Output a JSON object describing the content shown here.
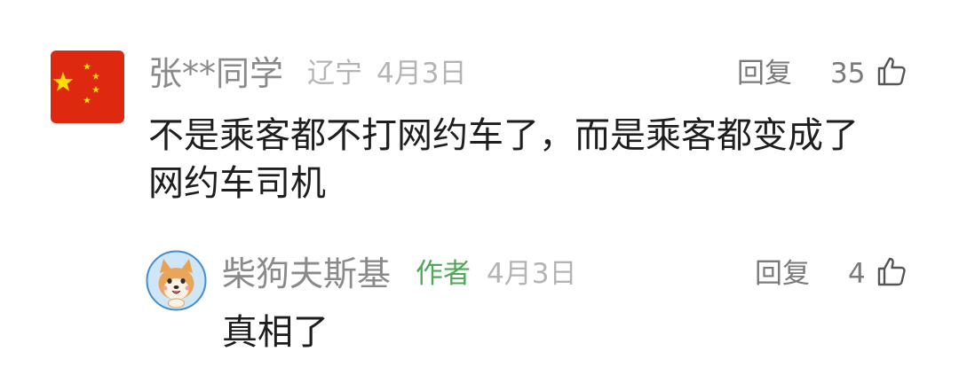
{
  "comments": [
    {
      "username": "张**同学",
      "region": "辽宁",
      "date": "4月3日",
      "reply_label": "回复",
      "likes": "35",
      "text": "不是乘客都不打网约车了，而是乘客都变成了\n网约车司机",
      "avatar_icon": "china-flag-icon"
    }
  ],
  "replies": [
    {
      "username": "柴狗夫斯基",
      "author_tag": "作者",
      "date": "4月3日",
      "reply_label": "回复",
      "likes": "4",
      "text": "真相了",
      "avatar_icon": "shiba-dog-avatar-icon"
    }
  ],
  "colors": {
    "username": "#8a8a8a",
    "meta": "#b4b4b4",
    "author_tag": "#4fa858",
    "body": "#1e1e1e",
    "flag_red": "#de2910",
    "flag_yellow": "#ffde00"
  }
}
